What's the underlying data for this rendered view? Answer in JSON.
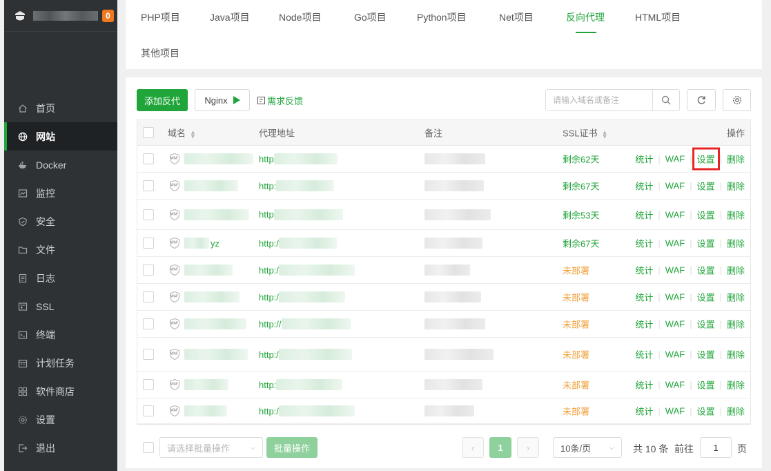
{
  "sidebar": {
    "badge": "0",
    "items": [
      {
        "label": "首页",
        "icon": "home-icon"
      },
      {
        "label": "网站",
        "icon": "globe-icon",
        "active": true
      },
      {
        "label": "Docker",
        "icon": "docker-icon"
      },
      {
        "label": "监控",
        "icon": "monitor-icon"
      },
      {
        "label": "安全",
        "icon": "shield-icon"
      },
      {
        "label": "文件",
        "icon": "folder-icon"
      },
      {
        "label": "日志",
        "icon": "log-icon"
      },
      {
        "label": "SSL",
        "icon": "ssl-icon"
      },
      {
        "label": "终端",
        "icon": "terminal-icon"
      },
      {
        "label": "计划任务",
        "icon": "calendar-icon"
      },
      {
        "label": "软件商店",
        "icon": "apps-icon"
      },
      {
        "label": "设置",
        "icon": "gear-icon"
      },
      {
        "label": "退出",
        "icon": "logout-icon"
      }
    ]
  },
  "tabs": [
    "PHP项目",
    "Java项目",
    "Node项目",
    "Go项目",
    "Python项目",
    "Net项目",
    "反向代理",
    "HTML项目",
    "其他项目"
  ],
  "active_tab": "反向代理",
  "toolbar": {
    "add_label": "添加反代",
    "nginx_label": "Nginx",
    "feedback_label": "需求反馈",
    "search_placeholder": "请输入域名或备注"
  },
  "table": {
    "headers": {
      "name": "域名",
      "proxy": "代理地址",
      "remark": "备注",
      "ssl": "SSL证书",
      "ops": "操作"
    },
    "ops": {
      "stats": "统计",
      "waf": "WAF",
      "settings": "设置",
      "delete": "删除"
    },
    "waf_badge": "WAF",
    "rows": [
      {
        "name_suffix": "",
        "proxy_prefix": "http",
        "ssl": "剩余62天",
        "ssl_state": "ok"
      },
      {
        "name_suffix": "",
        "proxy_prefix": "http:",
        "ssl": "剩余67天",
        "ssl_state": "ok"
      },
      {
        "name_suffix": "",
        "proxy_prefix": "http",
        "ssl": "剩余53天",
        "ssl_state": "ok"
      },
      {
        "name_suffix": "yz",
        "proxy_prefix": "http:/",
        "ssl": "剩余67天",
        "ssl_state": "ok"
      },
      {
        "name_suffix": "",
        "proxy_prefix": "http:/",
        "ssl": "未部署",
        "ssl_state": "none"
      },
      {
        "name_suffix": "",
        "proxy_prefix": "http:/",
        "ssl": "未部署",
        "ssl_state": "none"
      },
      {
        "name_suffix": "",
        "proxy_prefix": "http://",
        "ssl": "未部署",
        "ssl_state": "none"
      },
      {
        "name_suffix": "",
        "proxy_prefix": "http:/",
        "ssl": "未部署",
        "ssl_state": "none"
      },
      {
        "name_suffix": "",
        "proxy_prefix": "http:",
        "ssl": "未部署",
        "ssl_state": "none"
      },
      {
        "name_suffix": "",
        "proxy_prefix": "http:/",
        "ssl": "未部署",
        "ssl_state": "none"
      }
    ]
  },
  "footer": {
    "batch_placeholder": "请选择批量操作",
    "batch_button": "批量操作",
    "current_page": "1",
    "page_size": "10条/页",
    "total": "共 10 条",
    "goto_label": "前往",
    "goto_value": "1",
    "page_label": "页"
  },
  "colors": {
    "accent": "#20a53a",
    "warning": "#f0a13b",
    "highlight": "#e52525",
    "sidebar_bg": "#2f3235"
  }
}
